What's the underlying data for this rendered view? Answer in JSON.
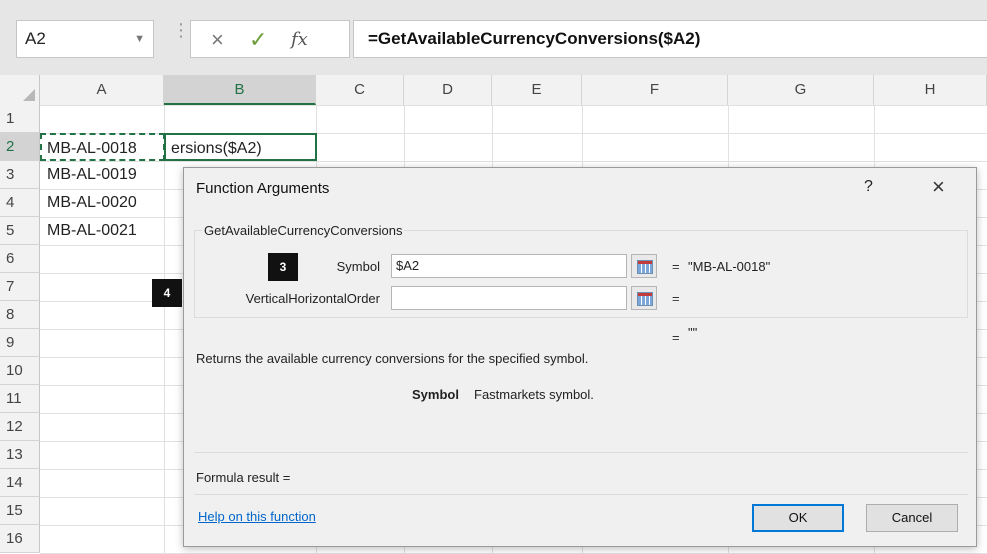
{
  "formula_bar": {
    "name_box": "A2",
    "cancel_icon": "×",
    "enter_icon": "✓",
    "fx_label": "fx",
    "formula": "=GetAvailableCurrencyConversions($A2)"
  },
  "grid": {
    "columns": [
      "A",
      "B",
      "C",
      "D",
      "E",
      "F",
      "G",
      "H"
    ],
    "selected_column": "B",
    "rows": [
      "1",
      "2",
      "3",
      "4",
      "5",
      "6",
      "7",
      "8",
      "9",
      "10",
      "11",
      "12",
      "13",
      "14",
      "15",
      "16"
    ],
    "selected_row": "2",
    "cells": {
      "A2": "MB-AL-0018",
      "B2": "ersions($A2)",
      "A3": "MB-AL-0019",
      "A4": "MB-AL-0020",
      "A5": "MB-AL-0021"
    }
  },
  "dialog": {
    "title": "Function Arguments",
    "help_glyph": "?",
    "close_glyph": "×",
    "function_name": "GetAvailableCurrencyConversions",
    "args": [
      {
        "label": "Symbol",
        "value": "$A2",
        "result": "\"MB-AL-0018\""
      },
      {
        "label": "VerticalHorizontalOrder",
        "value": "",
        "result": ""
      }
    ],
    "equals": "=",
    "overall_result": "\"\"",
    "description": "Returns the available currency conversions for the specified symbol.",
    "arg_help_name": "Symbol",
    "arg_help_text": "Fastmarkets symbol.",
    "formula_result_label": "Formula result =",
    "help_link": "Help on this function",
    "ok_label": "OK",
    "cancel_label": "Cancel"
  },
  "callouts": {
    "badge_3": "3",
    "badge_4": "4"
  },
  "colors": {
    "excel_green": "#217346",
    "link_blue": "#0066cc",
    "ok_border": "#0078d7"
  }
}
